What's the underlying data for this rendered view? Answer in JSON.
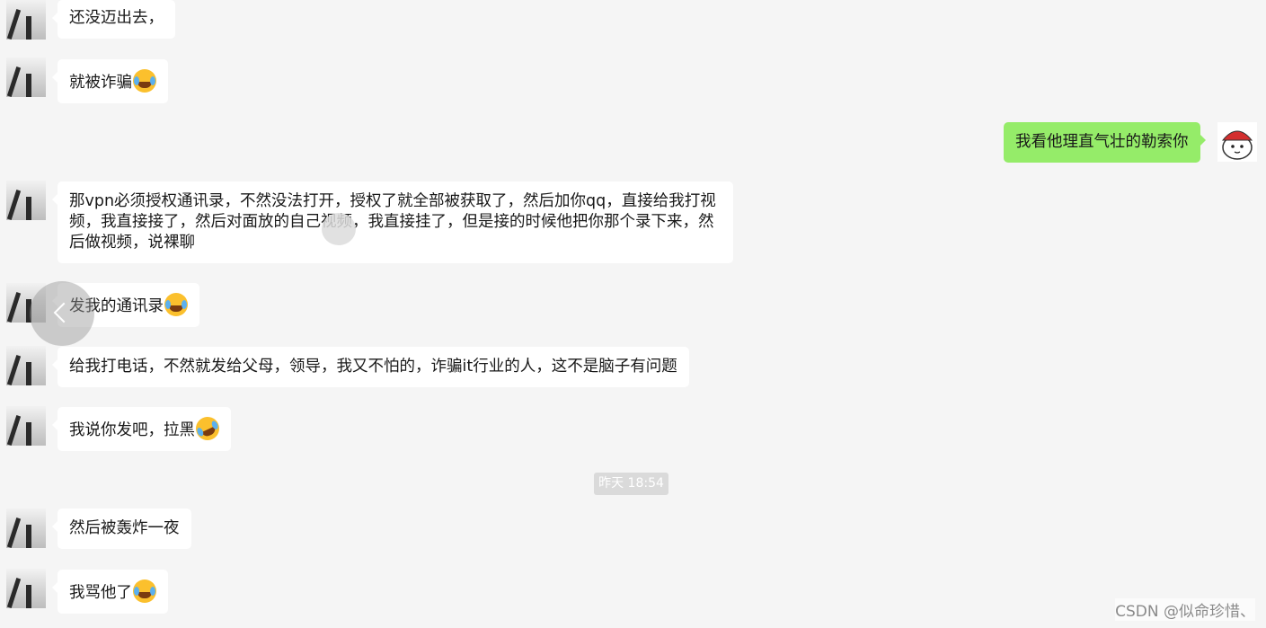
{
  "messages": [
    {
      "text": "还没迈出去，",
      "emoji": ""
    },
    {
      "text": "就被诈骗",
      "emoji": "laugh-cry-emoji"
    },
    {
      "text": "我看他理直气壮的勒索你",
      "side": "right"
    },
    {
      "text": "那vpn必须授权通讯录，不然没法打开，授权了就全部被获取了，然后加你qq，直接给我打视频，我直接接了，然后对面放的自己视频，我直接挂了，但是接的时候他把你那个录下来，然后做视频，说裸聊"
    },
    {
      "text": "发我的通讯录",
      "emoji": "laugh-cry-emoji"
    },
    {
      "text": "给我打电话，不然就发给父母，领导，我又不怕的，诈骗it行业的人，这不是脑子有问题"
    },
    {
      "text": "我说你发吧，拉黑",
      "emoji": "rofl-emoji"
    },
    {
      "text": "然后被轰炸一夜"
    },
    {
      "text": "我骂他了",
      "emoji": "laugh-cry-emoji"
    }
  ],
  "timestamp": "昨天 18:54",
  "watermark": "CSDN @似命珍惜、",
  "colors": {
    "background": "#f5f5f5",
    "self_bubble": "#95ec69",
    "other_bubble": "#ffffff"
  }
}
